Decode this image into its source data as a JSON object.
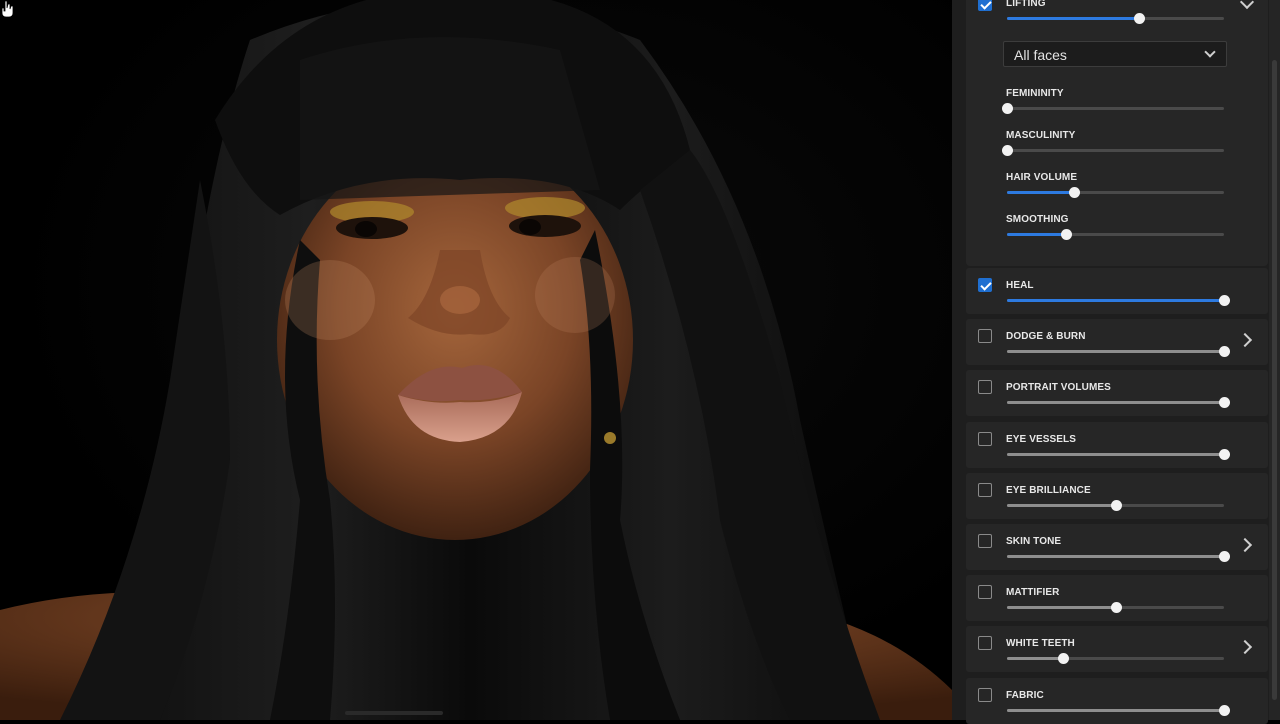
{
  "panel": {
    "lifting": {
      "label": "LIFTING",
      "checked": true,
      "value": 0.61
    },
    "faces_select": {
      "value": "All faces"
    },
    "sub_sliders": [
      {
        "label": "FEMININITY",
        "value": 0.0
      },
      {
        "label": "MASCULINITY",
        "value": 0.0
      },
      {
        "label": "HAIR VOLUME",
        "value": 0.31
      },
      {
        "label": "SMOOTHING",
        "value": 0.27
      }
    ],
    "tools": [
      {
        "label": "HEAL",
        "checked": true,
        "value": 1.0,
        "has_submenu": false
      },
      {
        "label": "DODGE & BURN",
        "checked": false,
        "value": 1.0,
        "has_submenu": true
      },
      {
        "label": "PORTRAIT VOLUMES",
        "checked": false,
        "value": 1.0,
        "has_submenu": false
      },
      {
        "label": "EYE VESSELS",
        "checked": false,
        "value": 1.0,
        "has_submenu": false
      },
      {
        "label": "EYE BRILLIANCE",
        "checked": false,
        "value": 0.5,
        "has_submenu": false
      },
      {
        "label": "SKIN TONE",
        "checked": false,
        "value": 1.0,
        "has_submenu": true
      },
      {
        "label": "MATTIFIER",
        "checked": false,
        "value": 0.5,
        "has_submenu": false
      },
      {
        "label": "WHITE TEETH",
        "checked": false,
        "value": 0.26,
        "has_submenu": true
      },
      {
        "label": "FABRIC",
        "checked": false,
        "value": 1.0,
        "has_submenu": false
      }
    ]
  },
  "icons": {
    "cursor": "hand-cursor-icon",
    "checkbox": "checkbox-icon",
    "chevron_right": "chevron-right-icon",
    "chevron_down": "chevron-down-icon"
  },
  "colors": {
    "accent": "#2d7ae0",
    "panel_bg": "#1e1e1e",
    "row_bg": "#262626",
    "photo_bg": "#000000"
  }
}
